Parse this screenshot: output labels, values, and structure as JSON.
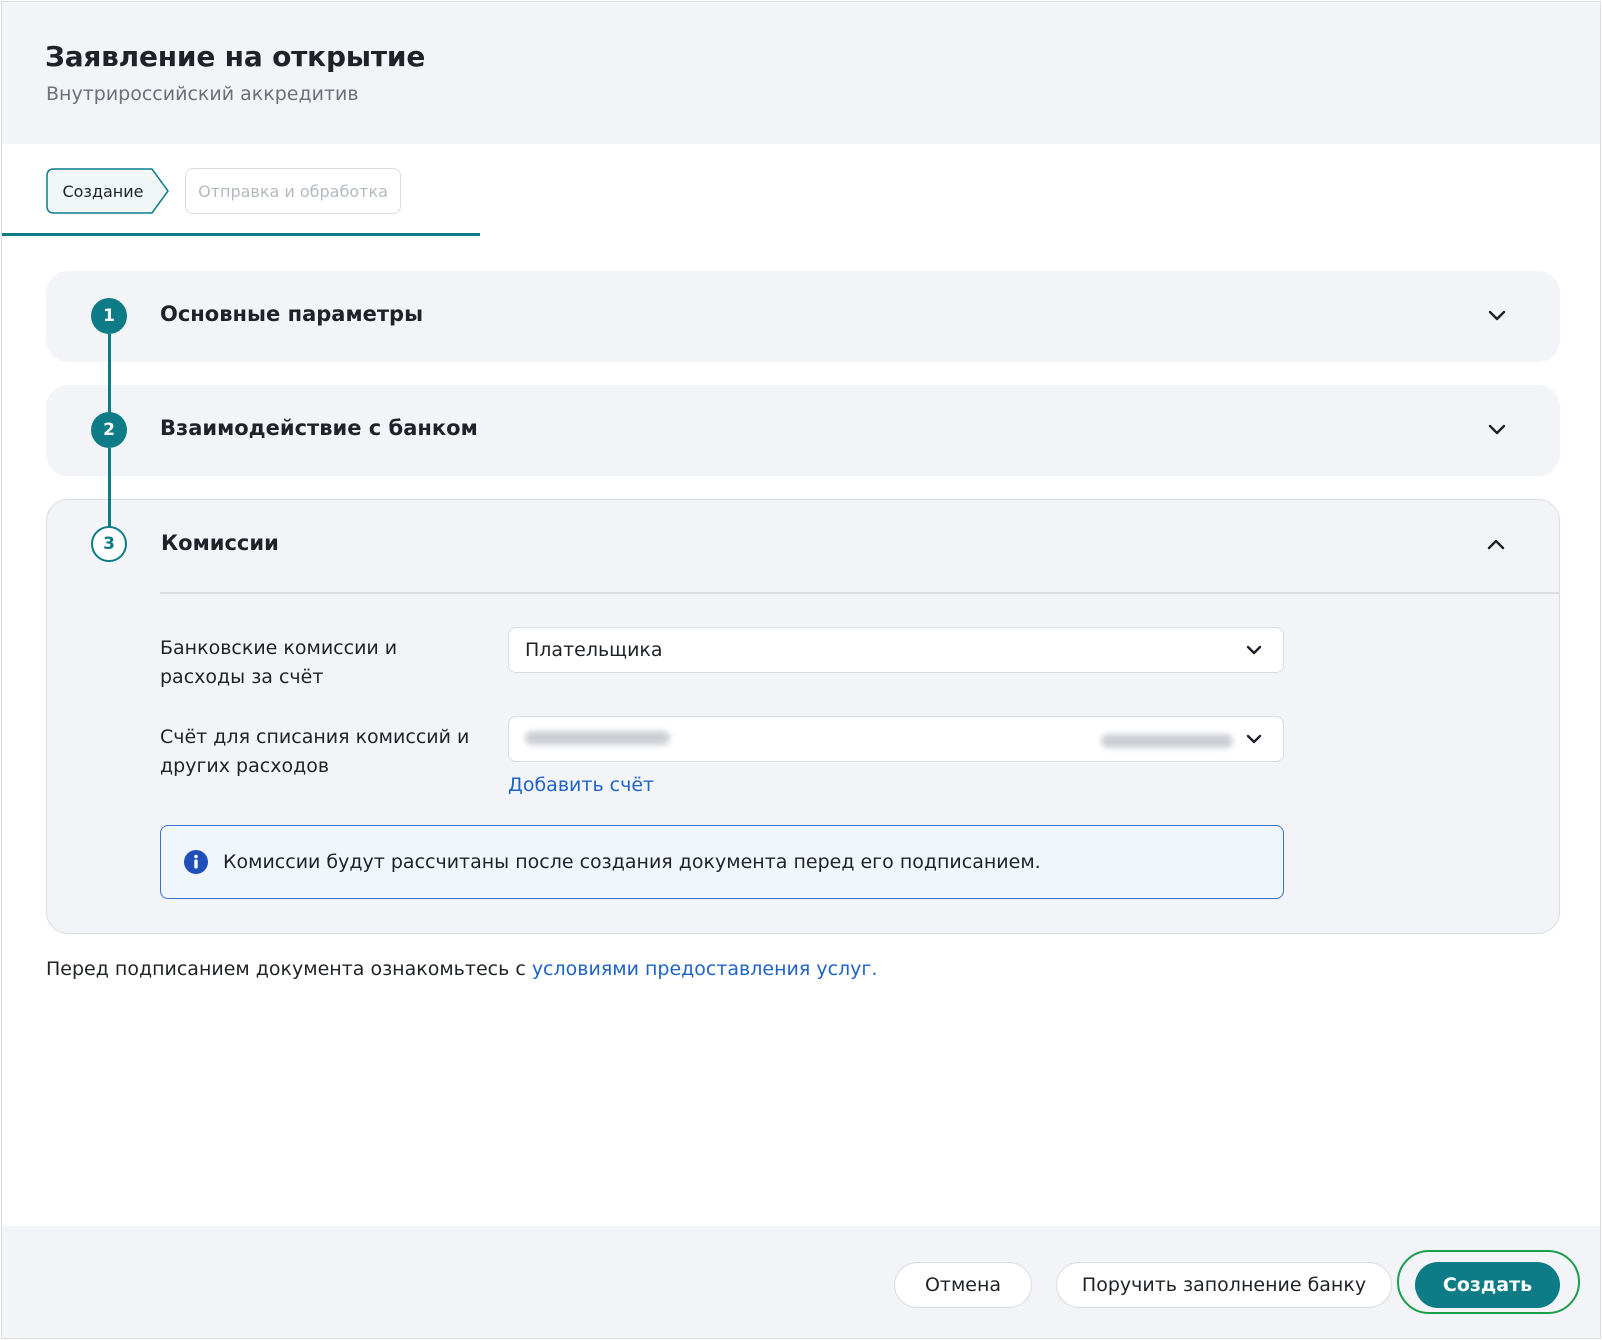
{
  "header": {
    "title": "Заявление на открытие",
    "subtitle": "Внутрироссийский аккредитив"
  },
  "stepper": {
    "steps": [
      {
        "label": "Создание",
        "state": "active"
      },
      {
        "label": "Отправка и обработка",
        "state": "inactive"
      }
    ]
  },
  "sections": [
    {
      "number": "1",
      "title": "Основные параметры",
      "expanded": false
    },
    {
      "number": "2",
      "title": "Взаимодействие с банком",
      "expanded": false
    },
    {
      "number": "3",
      "title": "Комиссии",
      "expanded": true
    }
  ],
  "commissions": {
    "fees_label": "Банковские комиссии и расходы за счёт",
    "fees_value": "Плательщика",
    "account_label": "Счёт для списания комиссий и других расходов",
    "add_account_link": "Добавить счёт",
    "info_text": "Комиссии будут рассчитаны после создания документа перед его подписанием."
  },
  "terms": {
    "prefix": "Перед подписанием документа ознакомьтесь с ",
    "link": "условиями предоставления услуг",
    "suffix": "."
  },
  "footer": {
    "cancel_label": "Отмена",
    "delegate_label": "Поручить заполнение банку",
    "create_label": "Создать"
  },
  "colors": {
    "accent": "#0e7c86",
    "link": "#1f63c6",
    "info_border": "#3d6fd1",
    "focus": "#1a9e4b"
  }
}
